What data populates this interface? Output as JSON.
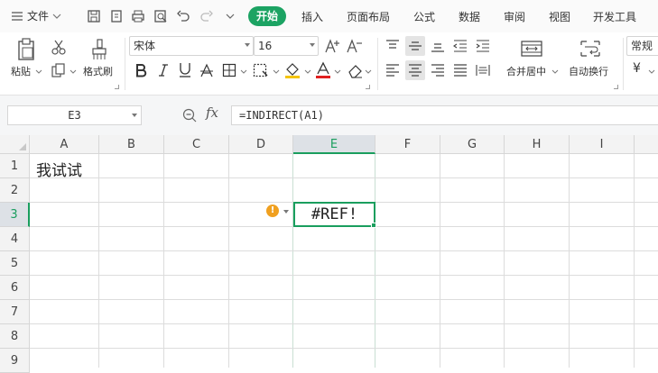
{
  "menu": {
    "file_label": "文件",
    "tabs": [
      "开始",
      "插入",
      "页面布局",
      "公式",
      "数据",
      "审阅",
      "视图",
      "开发工具"
    ],
    "active_tab": "开始"
  },
  "ribbon": {
    "paste_label": "粘贴",
    "format_painter_label": "格式刷",
    "font_name": "宋体",
    "font_size": "16",
    "merge_center_label": "合并居中",
    "wrap_text_label": "自动换行",
    "number_format": "常规",
    "currency_symbol": "¥",
    "font_color": "#e02020",
    "fill_color": "#f5c400"
  },
  "formula_bar": {
    "name_box": "E3",
    "fx_label": "fx",
    "formula": "=INDIRECT(A1)"
  },
  "grid": {
    "columns": [
      "A",
      "B",
      "C",
      "D",
      "E",
      "F",
      "G",
      "H",
      "I"
    ],
    "rows": [
      "1",
      "2",
      "3",
      "4",
      "5",
      "6",
      "7",
      "8",
      "9"
    ],
    "active_column": "E",
    "active_row": "3",
    "cells": {
      "A1": "我试试",
      "E3": "#REF!"
    },
    "error_indicator": "!"
  },
  "colors": {
    "accent": "#1a9e5e",
    "active_tab_bg": "#1ca363",
    "warning": "#f0a020"
  }
}
